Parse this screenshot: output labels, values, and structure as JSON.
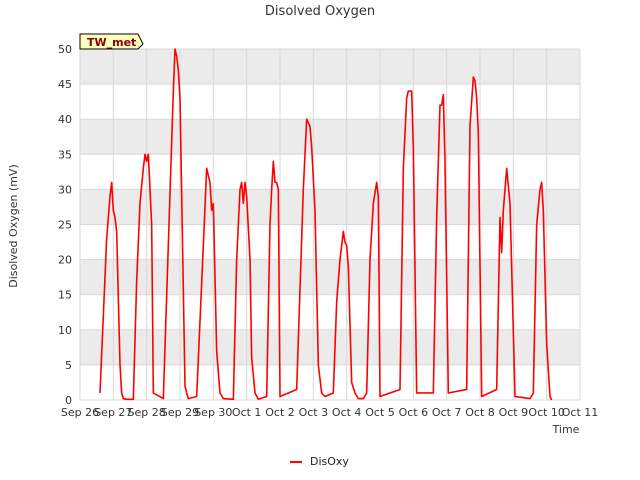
{
  "chart_data": {
    "type": "line",
    "title": "Disolved Oxygen",
    "xlabel": "Time",
    "ylabel": "Disolved Oxygen (mV)",
    "tag": "TW_met",
    "x_ticks": [
      "Sep 26",
      "Sep 27",
      "Sep 28",
      "Sep 29",
      "Sep 30",
      "Oct 1",
      "Oct 2",
      "Oct 3",
      "Oct 4",
      "Oct 5",
      "Oct 6",
      "Oct 7",
      "Oct 8",
      "Oct 9",
      "Oct 10",
      "Oct 11"
    ],
    "y_ticks": [
      0,
      5,
      10,
      15,
      20,
      25,
      30,
      35,
      40,
      45,
      50
    ],
    "xlim": [
      "Sep 26",
      "Oct 11"
    ],
    "ylim": [
      0,
      50
    ],
    "grid": true,
    "legend": "bottom-center",
    "colors": {
      "series": "#ff0000",
      "band": "#ebebeb",
      "grid": "#d9d9d9",
      "tag_fill": "#ffffc0"
    },
    "series": [
      {
        "name": "DisOxy",
        "points": [
          [
            "Sep 26 14:24",
            1
          ],
          [
            "Sep 26 16:48",
            12
          ],
          [
            "Sep 26 19:12",
            23
          ],
          [
            "Sep 26 21:36",
            29
          ],
          [
            "Sep 26 22:48",
            31
          ],
          [
            "Sep 27 00:00",
            27
          ],
          [
            "Sep 27 01:12",
            26
          ],
          [
            "Sep 27 02:24",
            24
          ],
          [
            "Sep 27 04:48",
            5
          ],
          [
            "Sep 27 06:00",
            1
          ],
          [
            "Sep 27 07:12",
            0.2
          ],
          [
            "Sep 27 09:36",
            0.1
          ],
          [
            "Sep 27 14:24",
            0.1
          ],
          [
            "Sep 27 16:48",
            17
          ],
          [
            "Sep 27 19:12",
            28
          ],
          [
            "Sep 27 21:36",
            33
          ],
          [
            "Sep 27 22:48",
            35
          ],
          [
            "Sep 28 00:00",
            34
          ],
          [
            "Sep 28 01:12",
            35
          ],
          [
            "Sep 28 03:36",
            25
          ],
          [
            "Sep 28 04:48",
            1
          ],
          [
            "Sep 28 12:00",
            0.2
          ],
          [
            "Sep 28 19:12",
            44
          ],
          [
            "Sep 28 20:24",
            50
          ],
          [
            "Sep 28 21:36",
            49
          ],
          [
            "Sep 28 22:48",
            47
          ],
          [
            "Sep 29 00:00",
            43
          ],
          [
            "Sep 29 03:36",
            2
          ],
          [
            "Sep 29 04:48",
            1
          ],
          [
            "Sep 29 06:00",
            0.2
          ],
          [
            "Sep 29 12:00",
            0.5
          ],
          [
            "Sep 29 16:48",
            22
          ],
          [
            "Sep 29 19:12",
            33
          ],
          [
            "Sep 29 21:36",
            31
          ],
          [
            "Sep 29 22:48",
            27
          ],
          [
            "Sep 30 00:00",
            28
          ],
          [
            "Sep 30 02:24",
            7
          ],
          [
            "Sep 30 04:48",
            1
          ],
          [
            "Sep 30 07:12",
            0.2
          ],
          [
            "Sep 30 14:24",
            0.1
          ],
          [
            "Sep 30 16:48",
            20
          ],
          [
            "Sep 30 19:12",
            30
          ],
          [
            "Sep 30 20:24",
            31
          ],
          [
            "Sep 30 21:36",
            28
          ],
          [
            "Sep 30 22:48",
            31
          ],
          [
            "Oct 1 00:00",
            29
          ],
          [
            "Oct 1 02:24",
            20
          ],
          [
            "Oct 1 03:36",
            6
          ],
          [
            "Oct 1 06:00",
            1
          ],
          [
            "Oct 1 08:24",
            0.1
          ],
          [
            "Oct 1 14:24",
            0.5
          ],
          [
            "Oct 1 16:48",
            25
          ],
          [
            "Oct 1 18:00",
            30
          ],
          [
            "Oct 1 19:12",
            34
          ],
          [
            "Oct 1 20:24",
            31
          ],
          [
            "Oct 1 21:36",
            31
          ],
          [
            "Oct 1 22:48",
            30
          ],
          [
            "Oct 2 00:00",
            0.5
          ],
          [
            "Oct 2 12:00",
            1.5
          ],
          [
            "Oct 2 16:48",
            30
          ],
          [
            "Oct 2 19:12",
            40
          ],
          [
            "Oct 2 21:36",
            39
          ],
          [
            "Oct 2 22:48",
            36
          ],
          [
            "Oct 3 01:12",
            27
          ],
          [
            "Oct 3 03:36",
            5
          ],
          [
            "Oct 3 06:00",
            1
          ],
          [
            "Oct 3 08:24",
            0.5
          ],
          [
            "Oct 3 14:24",
            1
          ],
          [
            "Oct 3 16:48",
            14
          ],
          [
            "Oct 3 19:12",
            20
          ],
          [
            "Oct 3 21:36",
            24
          ],
          [
            "Oct 3 22:48",
            22.5
          ],
          [
            "Oct 4 00:00",
            22
          ],
          [
            "Oct 4 01:12",
            19
          ],
          [
            "Oct 4 03:36",
            2.5
          ],
          [
            "Oct 4 06:00",
            1
          ],
          [
            "Oct 4 08:24",
            0.2
          ],
          [
            "Oct 4 12:00",
            0.2
          ],
          [
            "Oct 4 14:24",
            1
          ],
          [
            "Oct 4 16:48",
            20
          ],
          [
            "Oct 4 19:12",
            28
          ],
          [
            "Oct 4 21:36",
            31
          ],
          [
            "Oct 4 22:48",
            29
          ],
          [
            "Oct 5 00:00",
            0.5
          ],
          [
            "Oct 5 14:24",
            1.5
          ],
          [
            "Oct 5 16:48",
            33
          ],
          [
            "Oct 5 19:12",
            43
          ],
          [
            "Oct 5 20:24",
            44
          ],
          [
            "Oct 5 22:48",
            44
          ],
          [
            "Oct 6 00:00",
            36
          ],
          [
            "Oct 6 02:24",
            1
          ],
          [
            "Oct 6 14:24",
            1
          ],
          [
            "Oct 6 16:48",
            26
          ],
          [
            "Oct 6 19:12",
            42
          ],
          [
            "Oct 6 20:24",
            42
          ],
          [
            "Oct 6 21:36",
            43.5
          ],
          [
            "Oct 6 22:48",
            34
          ],
          [
            "Oct 7 01:12",
            1
          ],
          [
            "Oct 7 14:24",
            1.5
          ],
          [
            "Oct 7 16:48",
            39
          ],
          [
            "Oct 7 19:12",
            46
          ],
          [
            "Oct 7 20:24",
            45.5
          ],
          [
            "Oct 7 21:36",
            43
          ],
          [
            "Oct 7 22:48",
            38
          ],
          [
            "Oct 8 01:12",
            0.5
          ],
          [
            "Oct 8 12:00",
            1.5
          ],
          [
            "Oct 8 14:24",
            26
          ],
          [
            "Oct 8 15:36",
            21
          ],
          [
            "Oct 8 16:48",
            27
          ],
          [
            "Oct 8 19:12",
            33
          ],
          [
            "Oct 8 21:36",
            28
          ],
          [
            "Oct 9 01:12",
            0.5
          ],
          [
            "Oct 9 12:00",
            0.2
          ],
          [
            "Oct 9 14:24",
            1
          ],
          [
            "Oct 9 16:48",
            25
          ],
          [
            "Oct 9 19:12",
            30
          ],
          [
            "Oct 9 20:24",
            31
          ],
          [
            "Oct 9 21:36",
            27
          ],
          [
            "Oct 10 00:00",
            8
          ],
          [
            "Oct 10 02:24",
            0.5
          ],
          [
            "Oct 10 03:36",
            0
          ]
        ]
      }
    ]
  }
}
